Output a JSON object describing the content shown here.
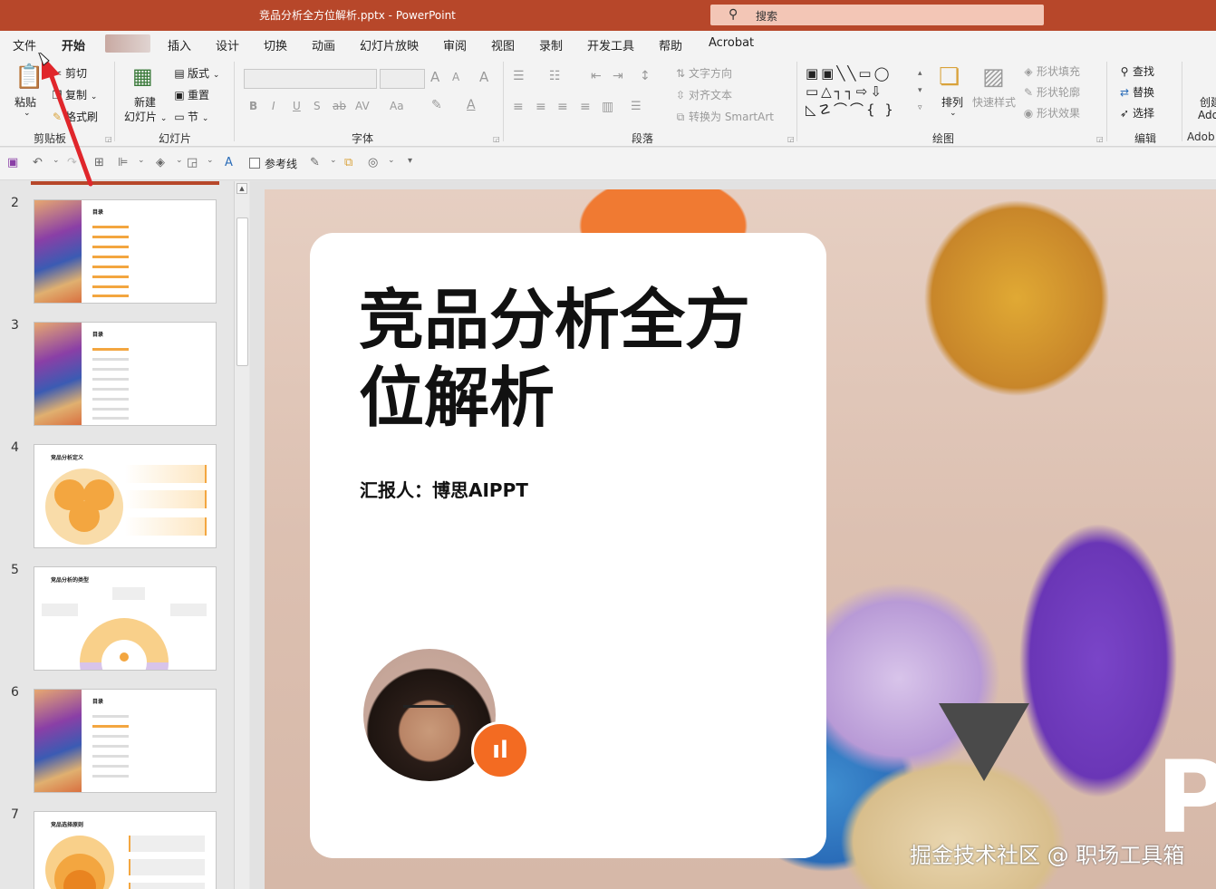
{
  "window": {
    "title": "竞品分析全方位解析.pptx  -  PowerPoint",
    "search_placeholder": "搜索"
  },
  "menu_tabs": [
    "文件",
    "开始",
    "插入",
    "设计",
    "切换",
    "动画",
    "幻灯片放映",
    "审阅",
    "视图",
    "录制",
    "开发工具",
    "帮助",
    "Acrobat"
  ],
  "ribbon": {
    "clipboard": {
      "paste": "粘贴",
      "cut": "剪切",
      "copy": "复制",
      "format_painter": "格式刷",
      "label": "剪贴板"
    },
    "slides": {
      "new_slide_line1": "新建",
      "new_slide_line2": "幻灯片",
      "layout": "版式",
      "reset": "重置",
      "section": "节",
      "label": "幻灯片"
    },
    "font": {
      "label": "字体",
      "bold": "B",
      "italic": "I",
      "underline": "U",
      "shadow": "S",
      "strike": "ab",
      "spacing": "AV",
      "case": "Aa",
      "grow": "A",
      "shrink": "A",
      "clear": "A"
    },
    "paragraph": {
      "text_direction": "文字方向",
      "align_text": "对齐文本",
      "smartart": "转换为 SmartArt",
      "label": "段落"
    },
    "drawing": {
      "arrange": "排列",
      "quick_styles": "快速样式",
      "fill": "形状填充",
      "outline": "形状轮廓",
      "effects": "形状效果",
      "label": "绘图"
    },
    "editing": {
      "find": "查找",
      "replace": "替换",
      "select": "选择",
      "label": "编辑"
    },
    "adobe": {
      "line1": "创建",
      "line2": "Ado",
      "label": "Adob"
    }
  },
  "qat": {
    "guides_label": "参考线"
  },
  "thumbnails": [
    {
      "num": "2",
      "kind": "toc",
      "title": "目录"
    },
    {
      "num": "3",
      "kind": "toc",
      "title": "目录"
    },
    {
      "num": "4",
      "kind": "definition",
      "title": "竞品分析定义"
    },
    {
      "num": "5",
      "kind": "types",
      "title": "竞品分析的类型"
    },
    {
      "num": "6",
      "kind": "toc",
      "title": "目录"
    },
    {
      "num": "7",
      "kind": "principles",
      "title": "竞品选择原则"
    }
  ],
  "slide": {
    "title": "竞品分析全方位解析",
    "reporter": "汇报人：博思AIPPT",
    "letter": "P"
  },
  "watermark": "掘金技术社区 @ 职场工具箱",
  "colors": {
    "accent": "#b7472a",
    "badge": "#f36b22"
  }
}
